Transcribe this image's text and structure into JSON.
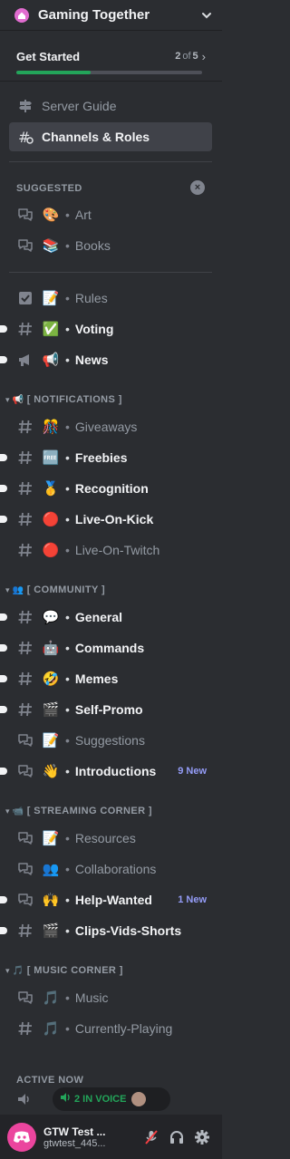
{
  "server": {
    "title": "Gaming Together"
  },
  "get_started": {
    "label": "Get Started",
    "current": "2",
    "of": "of",
    "total": "5",
    "progress_fraction": 0.4
  },
  "top_items": [
    {
      "name": "Server Guide"
    },
    {
      "name": "Channels & Roles"
    }
  ],
  "suggested": {
    "header": "SUGGESTED",
    "close_glyph": "×"
  },
  "suggested_channels": [
    {
      "emoji": "🎨",
      "name": "Art"
    },
    {
      "emoji": "📚",
      "name": "Books"
    }
  ],
  "top_channels": [
    {
      "emoji": "📝",
      "name": "Rules"
    },
    {
      "emoji": "✅",
      "name": "Voting"
    },
    {
      "emoji": "📢",
      "name": "News"
    }
  ],
  "categories": {
    "notifications": {
      "emoji": "📢",
      "name": "[ NOTIFICATIONS ]"
    },
    "community": {
      "emoji": "👥",
      "name": "[ COMMUNITY ]"
    },
    "streaming": {
      "emoji": "📹",
      "name": "[ STREAMING CORNER ]"
    },
    "music": {
      "emoji": "🎵",
      "name": "[ MUSIC CORNER ]"
    }
  },
  "notifications_channels": [
    {
      "emoji": "🎊",
      "name": "Giveaways"
    },
    {
      "emoji": "🆓",
      "name": "Freebies"
    },
    {
      "emoji": "🥇",
      "name": "Recognition"
    },
    {
      "emoji": "🔴",
      "name": "Live-On-Kick"
    },
    {
      "emoji": "🔴",
      "name": "Live-On-Twitch"
    }
  ],
  "community_channels": [
    {
      "emoji": "💬",
      "name": "General"
    },
    {
      "emoji": "🤖",
      "name": "Commands"
    },
    {
      "emoji": "🤣",
      "name": "Memes"
    },
    {
      "emoji": "🎬",
      "name": "Self-Promo"
    },
    {
      "emoji": "📝",
      "name": "Suggestions"
    },
    {
      "emoji": "👋",
      "name": "Introductions",
      "badge": "9 New"
    }
  ],
  "streaming_channels": [
    {
      "emoji": "📝",
      "name": "Resources"
    },
    {
      "emoji": "👥",
      "name": "Collaborations"
    },
    {
      "emoji": "🙌",
      "name": "Help-Wanted",
      "badge": "1 New"
    },
    {
      "emoji": "🎬",
      "name": "Clips-Vids-Shorts"
    }
  ],
  "music_channels": [
    {
      "emoji": "🎵",
      "name": "Music"
    },
    {
      "emoji": "🎵",
      "name": "Currently-Playing"
    }
  ],
  "active_now": {
    "header": "ACTIVE NOW",
    "voice_label": "2 IN VOICE"
  },
  "user": {
    "display_name": "GTW Test ...",
    "username": "gtwtest_445..."
  },
  "colors": {
    "accent": "#23a55a",
    "selected": "#404249",
    "new_badge": "#949cf7",
    "avatar": "#eb459e"
  }
}
